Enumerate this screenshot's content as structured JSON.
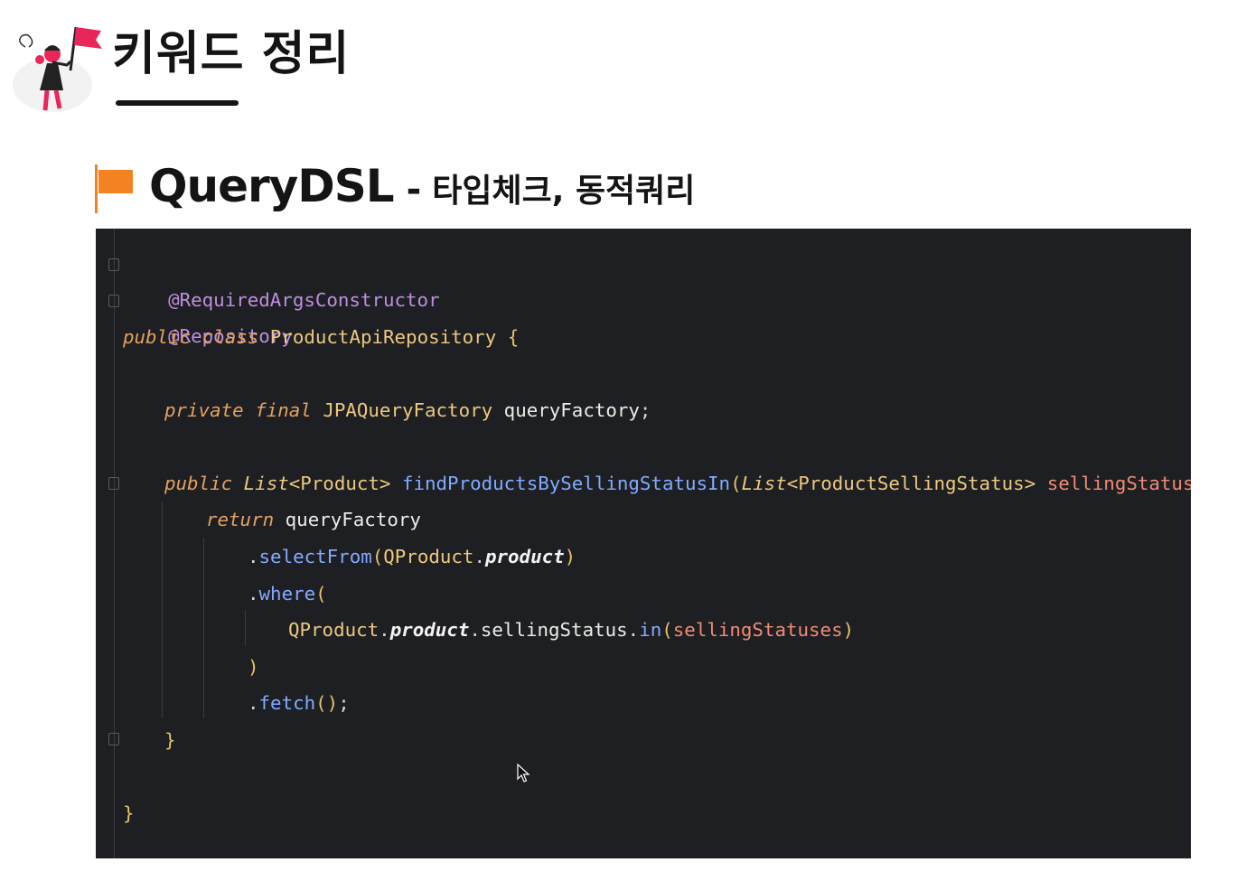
{
  "header": {
    "title": "키워드 정리"
  },
  "section": {
    "title_main": "QueryDSL",
    "title_dash": "-",
    "title_sub": "타입체크, 동적쿼리"
  },
  "colors": {
    "accent_flag": "#f58220",
    "code_background": "#1e1f22",
    "annotation": "#bd8ee0",
    "keyword": "#e4a15e",
    "class_name": "#ecc97e",
    "method": "#82aaff",
    "parameter": "#f08a74"
  },
  "icons": {
    "logo": "girl-with-flag-icon",
    "section": "orange-flag-icon",
    "cursor": "mouse-pointer-icon"
  },
  "code": {
    "annotation_1": "@RequiredArgsConstructor",
    "annotation_2": "@Repository",
    "kw_public": "public",
    "kw_class": "class",
    "class_name": "ProductApiRepository",
    "open_brace": "{",
    "kw_private": "private",
    "kw_final": "final",
    "field_type": "JPAQueryFactory",
    "field_name": "queryFactory",
    "semicolon": ";",
    "kw_public_2": "public",
    "return_list": "List",
    "return_generic": "<Product>",
    "method_name": "findProductsBySellingStatusIn",
    "paren_open": "(",
    "param_list": "List",
    "param_generic": "<ProductSellingStatus>",
    "param_name": "sellingStatuses",
    "paren_close": ")",
    "kw_return": "return",
    "query_factory": "queryFactory",
    "dot": ".",
    "select_from": "selectFrom",
    "qproduct": "QProduct",
    "product_field": "product",
    "where": "where",
    "selling_status": "sellingStatus",
    "in_method": "in",
    "fetch": "fetch",
    "fetch_parens": "()",
    "close_paren": ")",
    "close_brace": "}"
  }
}
